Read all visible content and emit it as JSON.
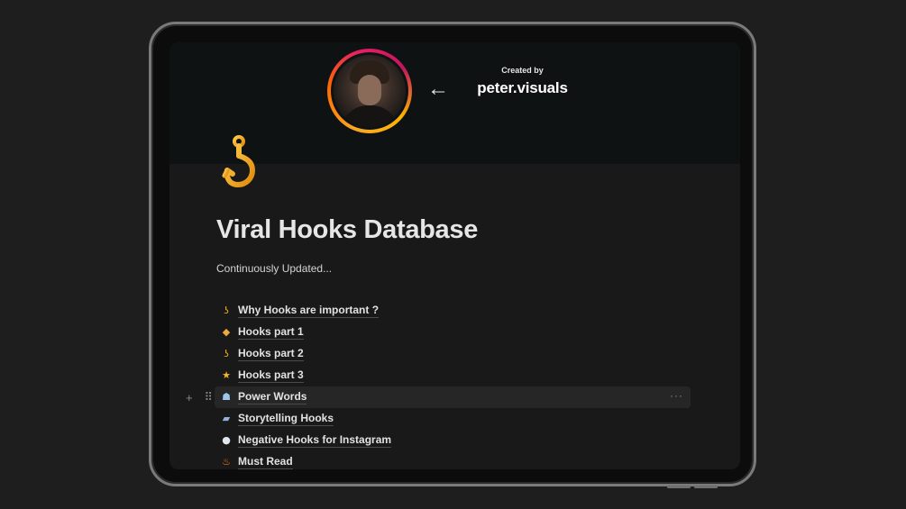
{
  "creator": {
    "created_by_label": "Created by",
    "name": "peter.visuals",
    "back_arrow": "←"
  },
  "page": {
    "icon": "hook-icon",
    "title": "Viral Hooks Database",
    "subtitle": "Continuously Updated..."
  },
  "links": [
    {
      "icon": "hook-icon",
      "glyph": "ʖ",
      "color": "#f5a623",
      "label": "Why Hooks are important ?"
    },
    {
      "icon": "fish-icon",
      "glyph": "◆",
      "color": "#f0a93c",
      "label": "Hooks part 1"
    },
    {
      "icon": "hook-icon",
      "glyph": "ʖ",
      "color": "#f5a623",
      "label": "Hooks part 2"
    },
    {
      "icon": "star-icon",
      "glyph": "★",
      "color": "#f6b825",
      "label": "Hooks part 3"
    },
    {
      "icon": "robot-icon",
      "glyph": "☗",
      "color": "#9fc5e8",
      "label": "Power Words"
    },
    {
      "icon": "book-icon",
      "glyph": "▰",
      "color": "#8fb3d9",
      "label": "Storytelling Hooks"
    },
    {
      "icon": "speech-bubble-icon",
      "glyph": "●",
      "color": "#dfe6ee",
      "label": "Negative Hooks for Instagram"
    },
    {
      "icon": "fire-icon",
      "glyph": "♨",
      "color": "#ff7a1a",
      "label": "Must Read"
    }
  ],
  "row_controls": {
    "add": "+",
    "drag": "⠿",
    "more": "···"
  },
  "colors": {
    "background": "#1e1e1e",
    "screen": "#191919",
    "cover": "#0f1213",
    "accent_hook": "#f5a623",
    "text": "#e6e6e6"
  }
}
